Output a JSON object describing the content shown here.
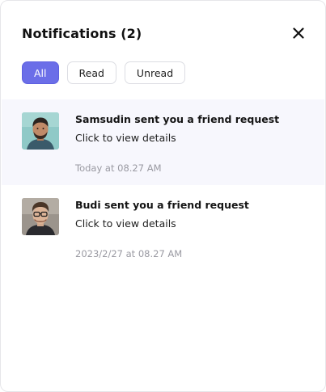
{
  "header": {
    "title": "Notifications (2)",
    "close_icon": "close-icon"
  },
  "filters": [
    {
      "label": "All",
      "active": true
    },
    {
      "label": "Read",
      "active": false
    },
    {
      "label": "Unread",
      "active": false
    }
  ],
  "notifications": [
    {
      "title": "Samsudin sent you a friend request",
      "subtitle": "Click to view details",
      "time": "Today at 08.27 AM",
      "unread": true,
      "avatar": "avatar-samsudin"
    },
    {
      "title": "Budi sent you a friend request",
      "subtitle": "Click to view details",
      "time": "2023/2/27 at 08.27 AM",
      "unread": false,
      "avatar": "avatar-budi"
    }
  ],
  "colors": {
    "accent": "#6b6ee8",
    "unread_bg": "#f7f7fd",
    "muted_text": "#9a9aa2"
  }
}
